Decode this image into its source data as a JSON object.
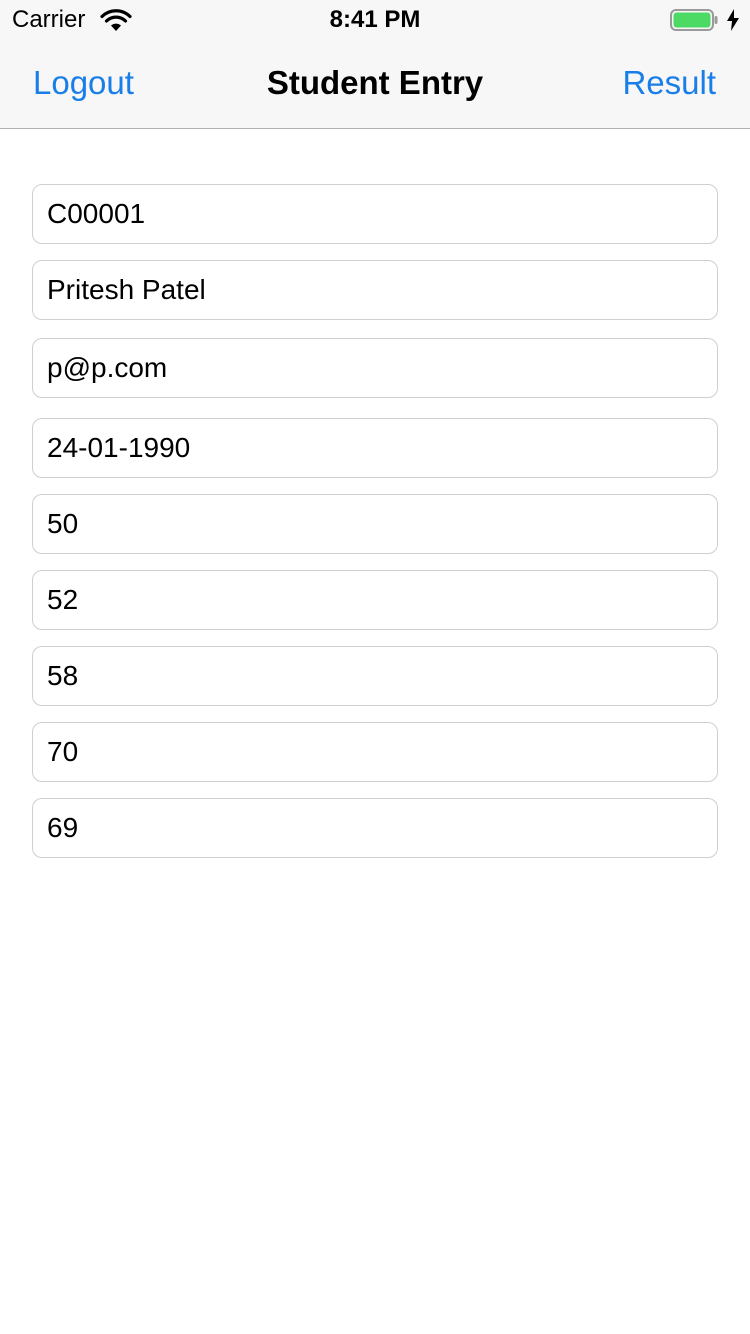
{
  "status_bar": {
    "carrier": "Carrier",
    "time": "8:41 PM",
    "battery_level": 1.0,
    "battery_color": "#4cd964",
    "icons": [
      "wifi-icon",
      "battery-icon",
      "charging-bolt-icon"
    ]
  },
  "nav": {
    "left_button": "Logout",
    "title": "Student Entry",
    "right_button": "Result",
    "accent_color": "#1a7ee8"
  },
  "fields": [
    {
      "value": "C00001"
    },
    {
      "value": "Pritesh Patel"
    },
    {
      "value": "p@p.com"
    },
    {
      "value": "24-01-1990"
    },
    {
      "value": "50"
    },
    {
      "value": "52"
    },
    {
      "value": "58"
    },
    {
      "value": "70"
    },
    {
      "value": "69"
    }
  ]
}
